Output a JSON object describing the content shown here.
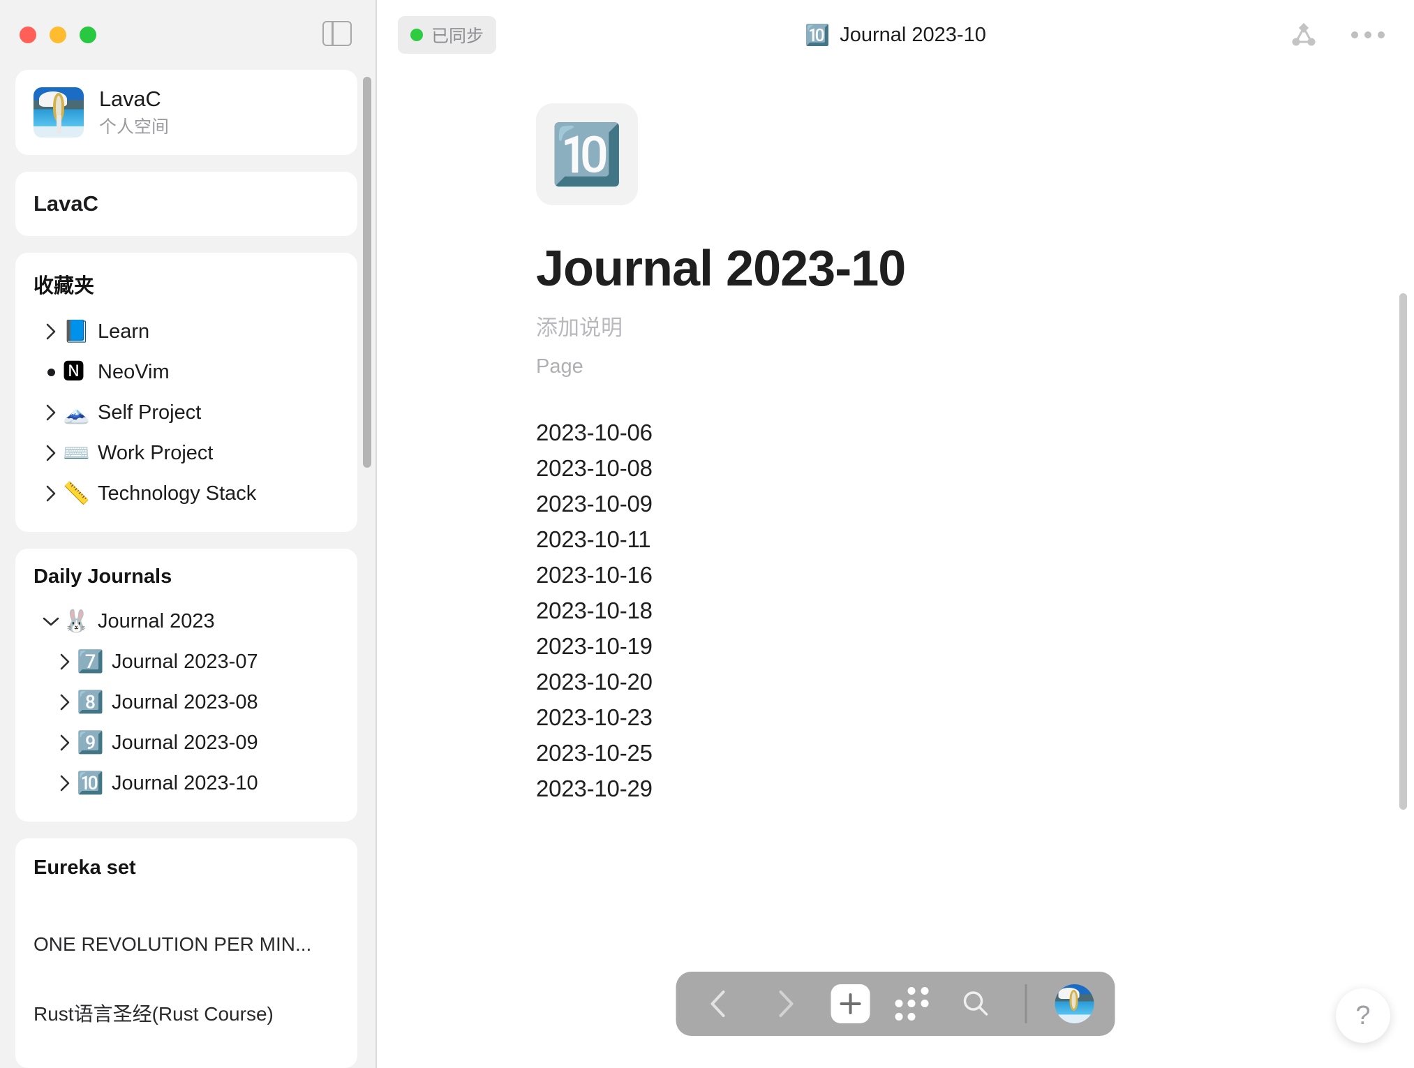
{
  "window": {
    "traffic_lights": [
      "close",
      "minimize",
      "maximize"
    ],
    "panel_toggle_label": "Toggle Sidebar"
  },
  "sidebar": {
    "workspace": {
      "name": "LavaC",
      "subtitle": "个人空间",
      "avatar_name": "workspace-avatar"
    },
    "name_card": {
      "title": "LavaC"
    },
    "favorites": {
      "title": "收藏夹",
      "items": [
        {
          "label": "Learn",
          "emoji": "📘",
          "marker": "chevron",
          "icon_name": "blue-book-icon"
        },
        {
          "label": "NeoVim",
          "emoji": "🅽",
          "marker": "bullet",
          "icon_name": "neovim-icon"
        },
        {
          "label": "Self Project",
          "emoji": "🗻",
          "marker": "chevron",
          "icon_name": "mount-fuji-icon"
        },
        {
          "label": "Work Project",
          "emoji": "⌨️",
          "marker": "chevron",
          "icon_name": "keyboard-icon"
        },
        {
          "label": "Technology Stack",
          "emoji": "📏",
          "marker": "chevron",
          "icon_name": "ruler-icon"
        }
      ]
    },
    "daily_journals": {
      "title": "Daily Journals",
      "items": [
        {
          "label": "Journal 2023",
          "emoji": "🐰",
          "marker": "chevron-down",
          "indent": false,
          "icon_name": "rabbit-face-icon"
        },
        {
          "label": "Journal 2023-07",
          "emoji": "7️⃣",
          "marker": "chevron",
          "indent": true,
          "icon_name": "keycap-7-icon"
        },
        {
          "label": "Journal 2023-08",
          "emoji": "8️⃣",
          "marker": "chevron",
          "indent": true,
          "icon_name": "keycap-8-icon"
        },
        {
          "label": "Journal 2023-09",
          "emoji": "9️⃣",
          "marker": "chevron",
          "indent": true,
          "icon_name": "keycap-9-icon"
        },
        {
          "label": "Journal 2023-10",
          "emoji": "🔟",
          "marker": "chevron",
          "indent": true,
          "icon_name": "keycap-10-icon"
        }
      ]
    },
    "eureka": {
      "title": "Eureka set",
      "items": [
        {
          "label": "ONE REVOLUTION PER MIN..."
        },
        {
          "label": "Rust语言圣经(Rust Course)"
        }
      ]
    }
  },
  "topbar": {
    "sync_status": "已同步",
    "sync_color": "#2ecc40",
    "title_emoji": "🔟",
    "title": "Journal 2023-10",
    "graph_icon_name": "graph-view-icon",
    "more_icon_name": "more-horizontal-icon"
  },
  "page": {
    "icon_emoji": "🔟",
    "title": "Journal 2023-10",
    "description_placeholder": "添加说明",
    "kind": "Page",
    "dates": [
      "2023-10-06",
      "2023-10-08",
      "2023-10-09",
      "2023-10-11",
      "2023-10-16",
      "2023-10-18",
      "2023-10-19",
      "2023-10-20",
      "2023-10-23",
      "2023-10-25",
      "2023-10-29"
    ]
  },
  "bottom_toolbar": {
    "back_label": "Back",
    "forward_label": "Forward",
    "add_label": "New",
    "apps_label": "Quick Access",
    "search_label": "Search",
    "avatar_label": "Account"
  },
  "help": {
    "label": "?"
  }
}
